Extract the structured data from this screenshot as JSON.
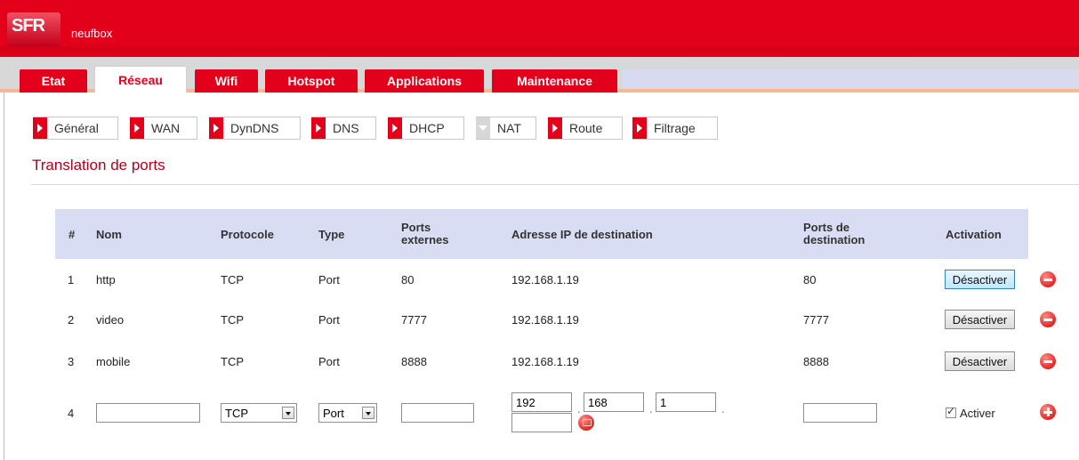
{
  "header": {
    "logo": "SFR",
    "product": "neufbox"
  },
  "main_tabs": [
    {
      "label": "Etat"
    },
    {
      "label": "Réseau"
    },
    {
      "label": "Wifi"
    },
    {
      "label": "Hotspot"
    },
    {
      "label": "Applications"
    },
    {
      "label": "Maintenance"
    }
  ],
  "sub_tabs": [
    {
      "label": "Général"
    },
    {
      "label": "WAN"
    },
    {
      "label": "DynDNS"
    },
    {
      "label": "DNS"
    },
    {
      "label": "DHCP"
    },
    {
      "label": "NAT"
    },
    {
      "label": "Route"
    },
    {
      "label": "Filtrage"
    }
  ],
  "section_title": "Translation de ports",
  "table": {
    "headers": {
      "num": "#",
      "nom": "Nom",
      "protocole": "Protocole",
      "type": "Type",
      "ports_ext_1": "Ports",
      "ports_ext_2": "externes",
      "ip": "Adresse IP de destination",
      "ports_dest_1": "Ports de",
      "ports_dest_2": "destination",
      "activation": "Activation"
    },
    "rows": [
      {
        "num": "1",
        "nom": "http",
        "protocole": "TCP",
        "type": "Port",
        "ports_ext": "80",
        "ip": "192.168.1.19",
        "ports_dest": "80",
        "action": "Désactiver"
      },
      {
        "num": "2",
        "nom": "video",
        "protocole": "TCP",
        "type": "Port",
        "ports_ext": "7777",
        "ip": "192.168.1.19",
        "ports_dest": "7777",
        "action": "Désactiver"
      },
      {
        "num": "3",
        "nom": "mobile",
        "protocole": "TCP",
        "type": "Port",
        "ports_ext": "8888",
        "ip": "192.168.1.19",
        "ports_dest": "8888",
        "action": "Désactiver"
      }
    ],
    "new_row": {
      "num": "4",
      "nom": "",
      "protocole": "TCP",
      "type": "Port",
      "ports_ext": "",
      "ip_octets": [
        "192",
        "168",
        "1",
        ""
      ],
      "ip_separator": ".",
      "ports_dest": "",
      "activer_checked": true,
      "activer_label": "Activer"
    }
  },
  "colors": {
    "brand_red": "#e2001a",
    "header_blue": "#d9ddf4",
    "title_red": "#b0001a"
  },
  "icons": {
    "delete": "minus-circle-icon",
    "add": "plus-circle-icon",
    "router": "router-icon",
    "tab_arrow": "arrow-right-icon"
  }
}
